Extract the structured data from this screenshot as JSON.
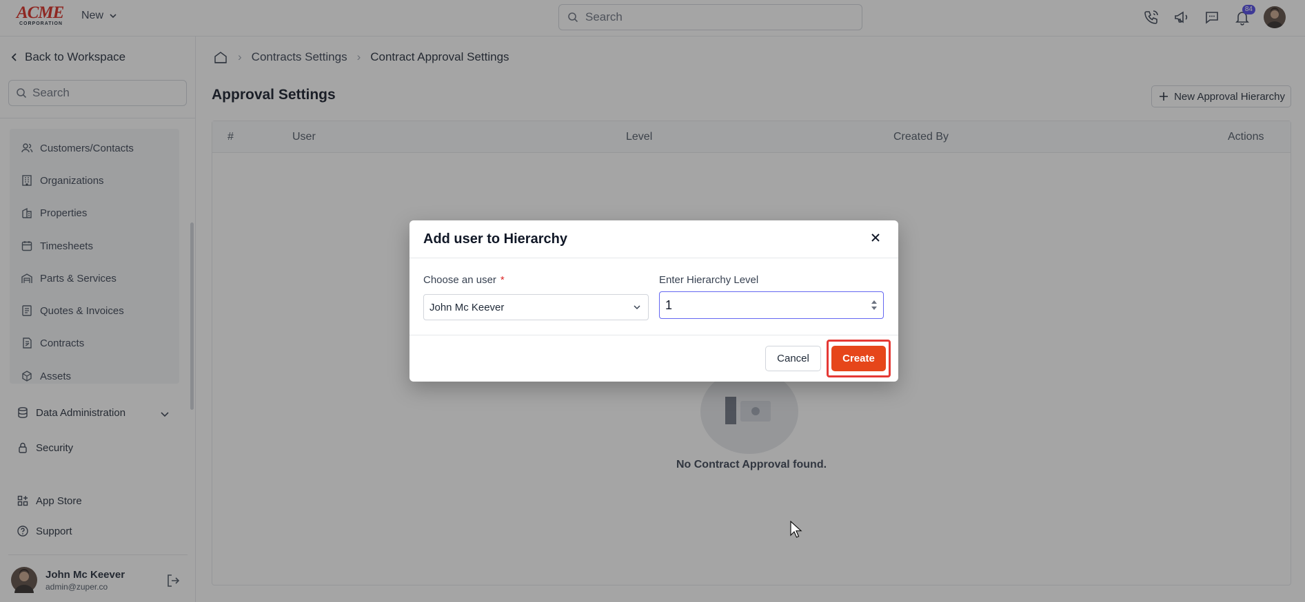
{
  "topbar": {
    "logo_main": "ACME",
    "logo_sub": "CORPORATION",
    "new_label": "New",
    "search_placeholder": "Search",
    "notification_count": "84"
  },
  "sidebar": {
    "back_label": "Back to Workspace",
    "search_placeholder": "Search",
    "sub_items": [
      {
        "label": "Customers/Contacts",
        "icon": "users-icon"
      },
      {
        "label": "Organizations",
        "icon": "building-icon"
      },
      {
        "label": "Properties",
        "icon": "property-icon"
      },
      {
        "label": "Timesheets",
        "icon": "calendar-icon"
      },
      {
        "label": "Parts & Services",
        "icon": "warehouse-icon"
      },
      {
        "label": "Quotes & Invoices",
        "icon": "invoice-icon"
      },
      {
        "label": "Contracts",
        "icon": "contract-icon"
      },
      {
        "label": "Assets",
        "icon": "cube-icon"
      }
    ],
    "data_admin_label": "Data Administration",
    "security_label": "Security",
    "app_store_label": "App Store",
    "support_label": "Support",
    "user_name": "John Mc Keever",
    "user_email": "admin@zuper.co"
  },
  "main": {
    "breadcrumb": [
      "Contracts Settings",
      "Contract Approval Settings"
    ],
    "title": "Approval Settings",
    "new_hierarchy_label": "New Approval Hierarchy",
    "columns": [
      "#",
      "User",
      "Level",
      "Created By",
      "Actions"
    ],
    "empty_text": "No Contract Approval found."
  },
  "modal": {
    "title": "Add user to Hierarchy",
    "user_label": "Choose an user",
    "required_mark": "*",
    "user_value": "John Mc Keever",
    "level_label": "Enter Hierarchy Level",
    "level_value": "1",
    "cancel_label": "Cancel",
    "create_label": "Create"
  },
  "colors": {
    "brand": "#d7261e",
    "primary_button": "#e6461a",
    "focus": "#6366f1",
    "highlight": "#e53935"
  }
}
